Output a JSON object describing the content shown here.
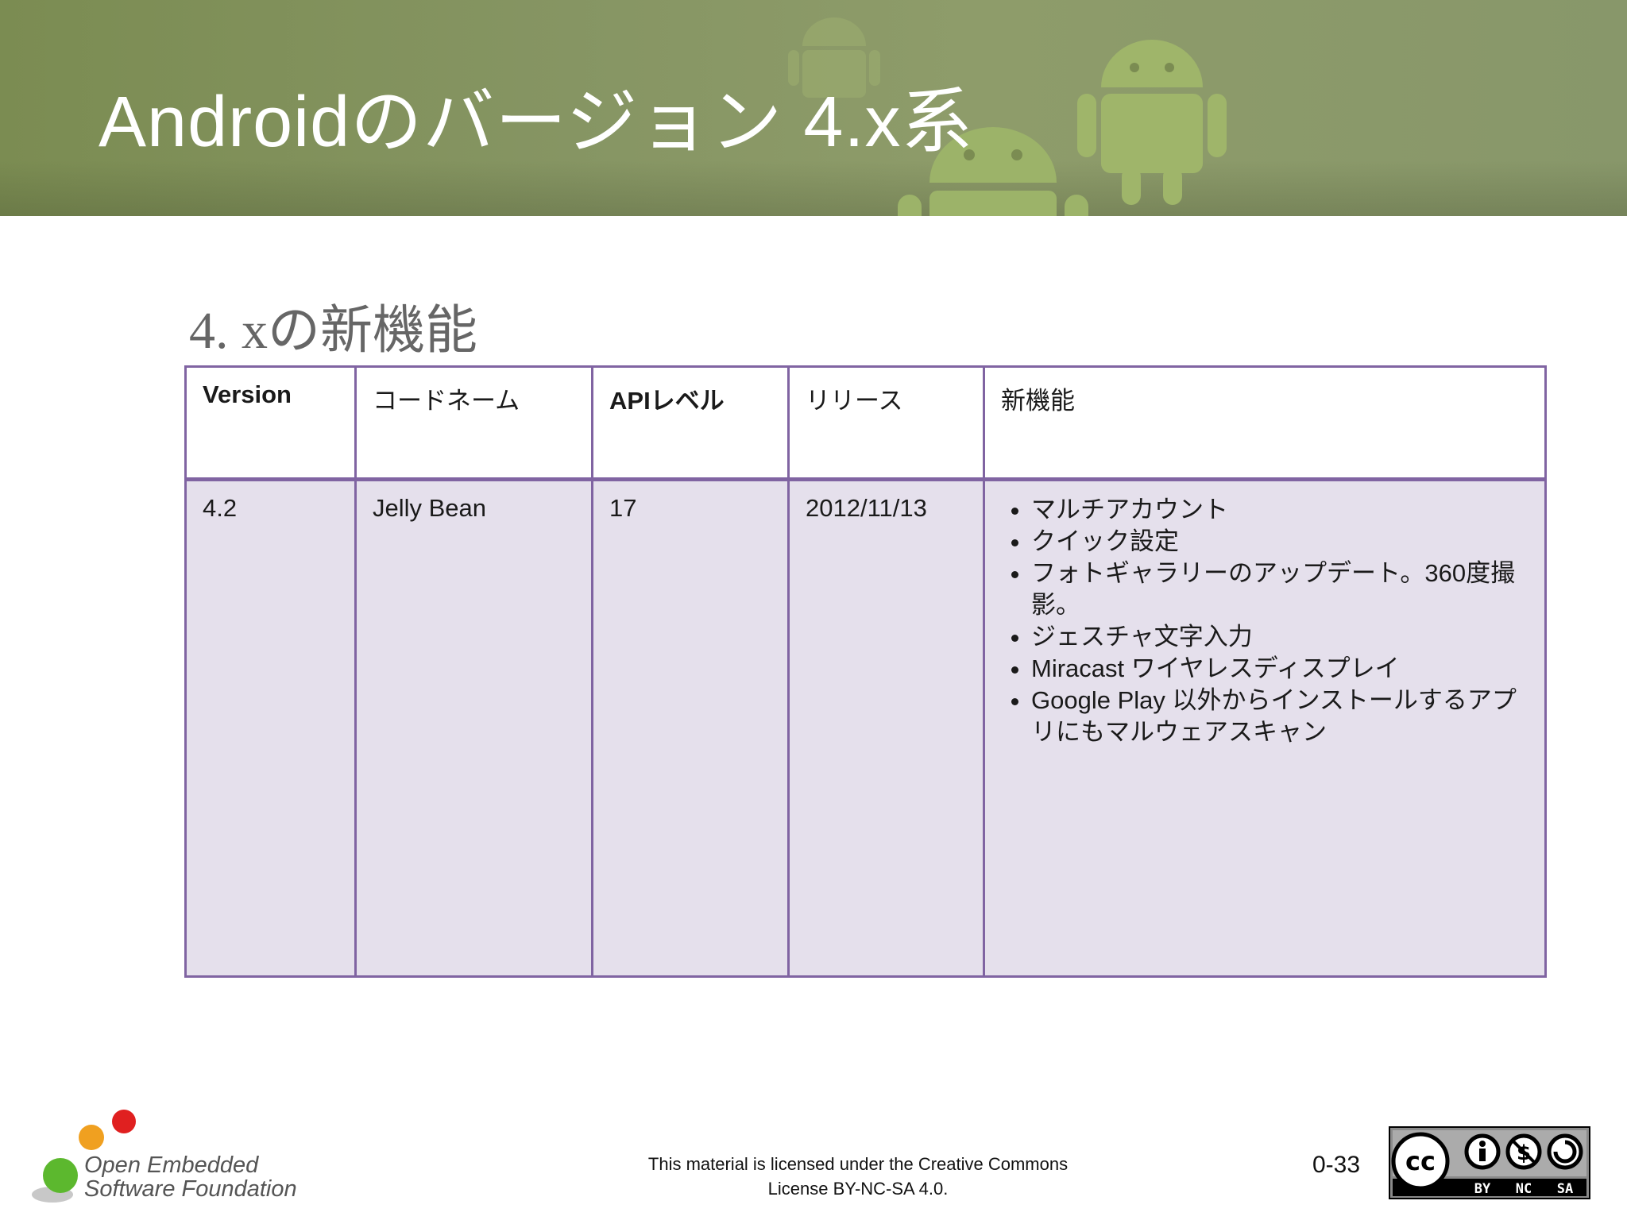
{
  "header": {
    "title": "Androidのバージョン 4.x系"
  },
  "subtitle": "4. xの新機能",
  "table": {
    "headers": [
      "Version",
      "コードネーム",
      "APIレベル",
      "リリース",
      "新機能"
    ],
    "row": {
      "version": "4.2",
      "codename": "Jelly Bean",
      "api": "17",
      "release": "2012/11/13",
      "features": [
        "マルチアカウント",
        "クイック設定",
        "フォトギャラリーのアップデート。360度撮影。",
        "ジェスチャ文字入力",
        "Miracast ワイヤレスディスプレイ",
        "Google Play 以外からインストールするアプリにもマルウェアスキャン"
      ]
    }
  },
  "footer": {
    "logo_line1": "Open Embedded",
    "logo_line2": "Software Foundation",
    "license_line1": "This material is licensed under the Creative Commons",
    "license_line2": "License BY-NC-SA 4.0.",
    "page_number": "0-33",
    "cc_labels": [
      "BY",
      "NC",
      "SA"
    ]
  },
  "colors": {
    "header_green": "#869563",
    "table_border": "#8064a2",
    "table_body": "#e5e0ec"
  }
}
